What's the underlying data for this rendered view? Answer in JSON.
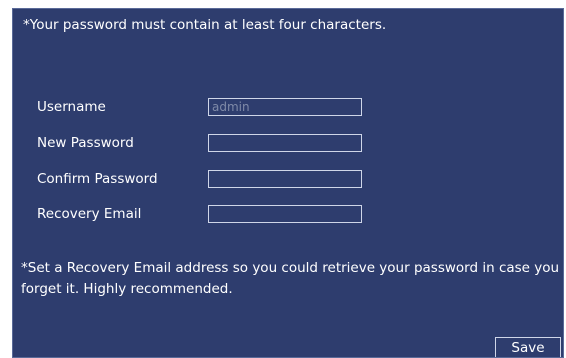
{
  "notice_top": "*Your password must contain at least four characters.",
  "fields": {
    "username": {
      "label": "Username",
      "value": "admin"
    },
    "new_password": {
      "label": "New Password",
      "value": ""
    },
    "confirm_password": {
      "label": "Confirm Password",
      "value": ""
    },
    "recovery_email": {
      "label": "Recovery Email",
      "value": ""
    }
  },
  "notice_bottom": "*Set a Recovery Email address so you could retrieve your password in case you forget it. Highly recommended.",
  "save_label": "Save",
  "colors": {
    "panel_background": "#2e3d6e",
    "text": "#ffffff",
    "input_border": "#cfd6e8",
    "input_text_disabled": "#7f8aa8"
  }
}
